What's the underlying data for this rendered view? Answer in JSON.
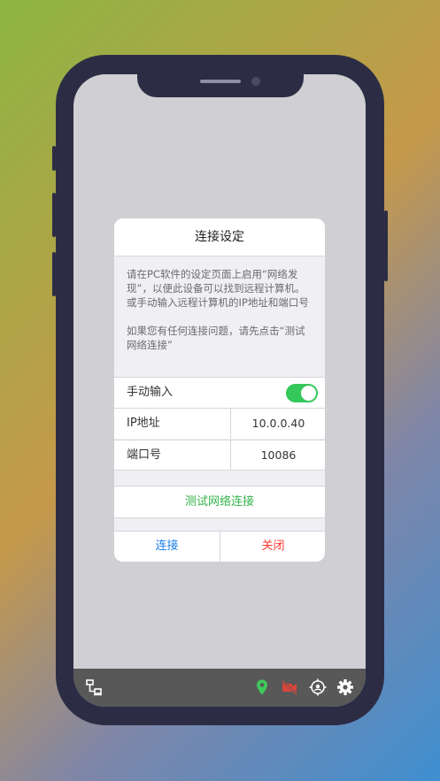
{
  "dialog": {
    "title": "连接设定",
    "description_1": "请在PC软件的设定页面上启用“网络发现”，以便此设备可以找到远程计算机。或手动输入远程计算机的IP地址和端口号",
    "description_2": "如果您有任何连接问题，请先点击“测试网络连接”",
    "manual_input_label": "手动输入",
    "manual_input_enabled": true,
    "ip_label": "IP地址",
    "ip_value": "10.0.0.40",
    "port_label": "端口号",
    "port_value": "10086",
    "test_button": "测试网络连接",
    "connect_button": "连接",
    "close_button": "关闭"
  },
  "bottom_bar": {
    "icons": [
      "network-icon",
      "location-pin-icon",
      "video-off-icon",
      "crosshair-icon",
      "gear-icon"
    ]
  },
  "colors": {
    "accent_green": "#34b449",
    "toggle_green": "#34c759",
    "link_blue": "#1a7ee8",
    "danger_red": "#ff3b30",
    "phone_frame": "#2c2d45"
  }
}
